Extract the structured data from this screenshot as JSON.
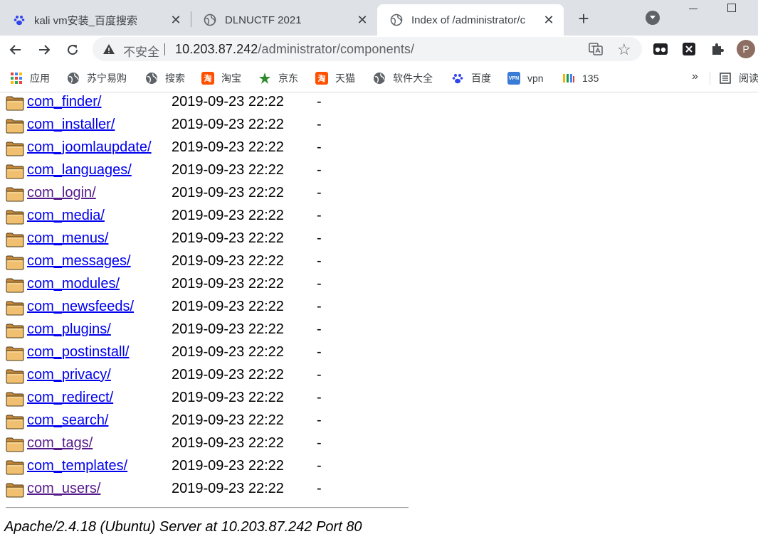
{
  "tabs": [
    {
      "title": "kali vm安装_百度搜索",
      "favicon": "baidu-paw-icon",
      "active": false
    },
    {
      "title": "DLNUCTF 2021",
      "favicon": "globe-icon",
      "active": false
    },
    {
      "title": "Index of /administrator/c",
      "favicon": "globe-icon",
      "active": true
    }
  ],
  "tab_close_glyph": "✕",
  "new_tab_glyph": "+",
  "address_bar": {
    "security_label": "不安全",
    "host": "10.203.87.242",
    "path": "/administrator/components/"
  },
  "profile_initial": "P",
  "bookmarks": [
    {
      "label": "应用",
      "icon": "apps-grid-icon"
    },
    {
      "label": "苏宁易购",
      "icon": "globe-icon"
    },
    {
      "label": "搜索",
      "icon": "globe-icon"
    },
    {
      "label": "淘宝",
      "icon": "taobao-icon"
    },
    {
      "label": "京东",
      "icon": "jd-icon"
    },
    {
      "label": "天猫",
      "icon": "taobao-icon"
    },
    {
      "label": "软件大全",
      "icon": "globe-icon"
    },
    {
      "label": "百度",
      "icon": "baidu-paw-icon"
    },
    {
      "label": "vpn",
      "icon": "vpn-icon"
    },
    {
      "label": "135",
      "icon": "135-icon"
    }
  ],
  "bookmarks_more": "»",
  "reading_list_label": "阅读",
  "listing": {
    "rows": [
      {
        "name": "com_finder/",
        "date": "2019-09-23 22:22",
        "size": "-",
        "visited": false
      },
      {
        "name": "com_installer/",
        "date": "2019-09-23 22:22",
        "size": "-",
        "visited": false
      },
      {
        "name": "com_joomlaupdate/",
        "date": "2019-09-23 22:22",
        "size": "-",
        "visited": false
      },
      {
        "name": "com_languages/",
        "date": "2019-09-23 22:22",
        "size": "-",
        "visited": false
      },
      {
        "name": "com_login/",
        "date": "2019-09-23 22:22",
        "size": "-",
        "visited": true
      },
      {
        "name": "com_media/",
        "date": "2019-09-23 22:22",
        "size": "-",
        "visited": false
      },
      {
        "name": "com_menus/",
        "date": "2019-09-23 22:22",
        "size": "-",
        "visited": false
      },
      {
        "name": "com_messages/",
        "date": "2019-09-23 22:22",
        "size": "-",
        "visited": false
      },
      {
        "name": "com_modules/",
        "date": "2019-09-23 22:22",
        "size": "-",
        "visited": false
      },
      {
        "name": "com_newsfeeds/",
        "date": "2019-09-23 22:22",
        "size": "-",
        "visited": false
      },
      {
        "name": "com_plugins/",
        "date": "2019-09-23 22:22",
        "size": "-",
        "visited": false
      },
      {
        "name": "com_postinstall/",
        "date": "2019-09-23 22:22",
        "size": "-",
        "visited": false
      },
      {
        "name": "com_privacy/",
        "date": "2019-09-23 22:22",
        "size": "-",
        "visited": false
      },
      {
        "name": "com_redirect/",
        "date": "2019-09-23 22:22",
        "size": "-",
        "visited": false
      },
      {
        "name": "com_search/",
        "date": "2019-09-23 22:22",
        "size": "-",
        "visited": false
      },
      {
        "name": "com_tags/",
        "date": "2019-09-23 22:22",
        "size": "-",
        "visited": true
      },
      {
        "name": "com_templates/",
        "date": "2019-09-23 22:22",
        "size": "-",
        "visited": false
      },
      {
        "name": "com_users/",
        "date": "2019-09-23 22:22",
        "size": "-",
        "visited": true
      }
    ],
    "server_signature": "Apache/2.4.18 (Ubuntu) Server at 10.203.87.242 Port 80"
  },
  "colors": {
    "link": "#0000ee",
    "visited_link": "#551a8b",
    "folder_fill": "#f0c070"
  }
}
